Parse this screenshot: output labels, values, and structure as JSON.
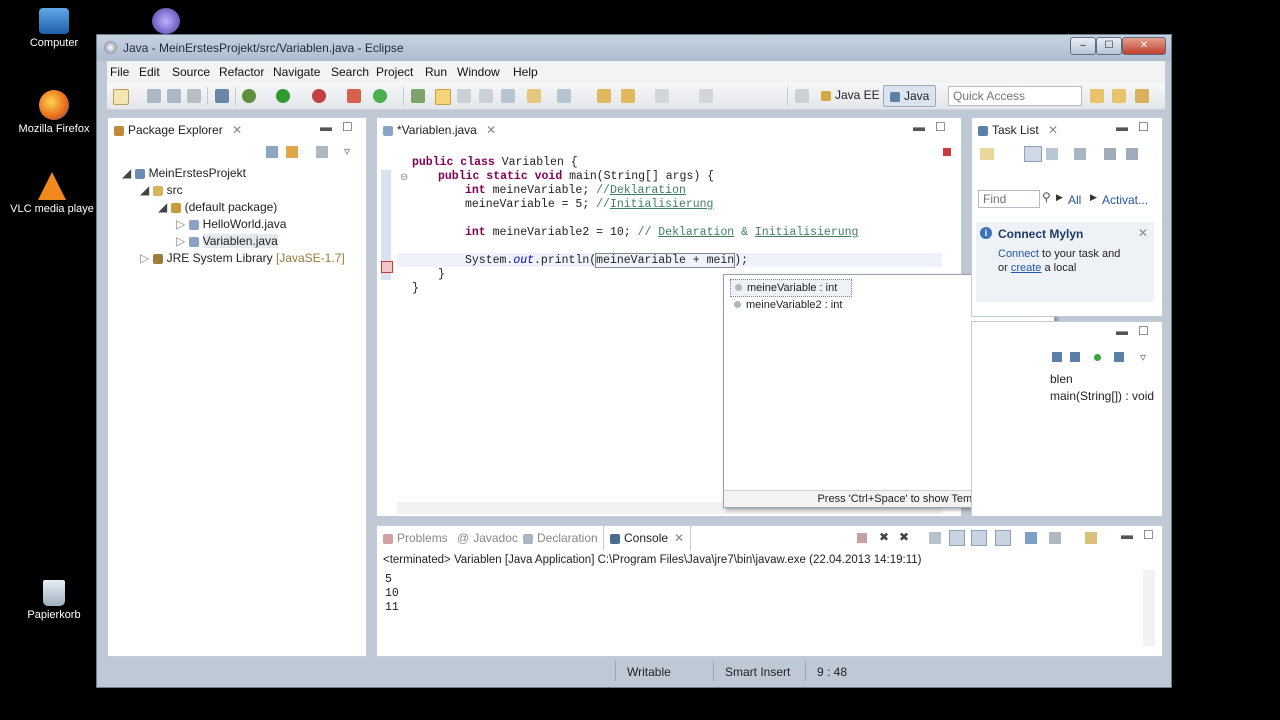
{
  "desktop": {
    "icons": [
      {
        "label": "Computer",
        "icon": "computer-icon"
      },
      {
        "label": "Mozilla Firefox",
        "icon": "firefox-icon"
      },
      {
        "label": "VLC media playe",
        "icon": "vlc-icon"
      },
      {
        "label": "Papierkorb",
        "icon": "recycle-bin-icon"
      }
    ]
  },
  "window": {
    "title": "Java - MeinErstesProjekt/src/Variablen.java - Eclipse",
    "controls": {
      "minimize": "‒",
      "maximize": "☐",
      "close": "✕"
    }
  },
  "menu": [
    "File",
    "Edit",
    "Source",
    "Refactor",
    "Navigate",
    "Search",
    "Project",
    "Run",
    "Window",
    "Help"
  ],
  "toolbar": {
    "perspective_java_ee": "Java EE",
    "perspective_java": "Java",
    "quick_access_placeholder": "Quick Access"
  },
  "package_explorer": {
    "tab": "Package Explorer",
    "tree": {
      "project": "MeinErstesProjekt",
      "src": "src",
      "package": "(default package)",
      "files": [
        "HelloWorld.java",
        "Variablen.java"
      ],
      "library": "JRE System Library",
      "library_version": "[JavaSE-1.7]"
    }
  },
  "editor": {
    "tab": "*Variablen.java",
    "code": {
      "l1_kw": "public class",
      "l1_rest": " Variablen {",
      "l2_kw": "public static void",
      "l2_rest": " main(String[] args) {",
      "l3_kw": "int",
      "l3_rest": " meineVariable; ",
      "l3_cm_prefix": "//",
      "l3_cm_word": "Deklaration",
      "l4_rest": "meineVariable = 5; ",
      "l4_cm_prefix": "//",
      "l4_cm_word": "Initialisierung",
      "l5_kw": "int",
      "l5_rest": " meineVariable2 = 10; ",
      "l5_cm_prefix": "// ",
      "l5_cm_word1": "Deklaration",
      "l5_cm_mid": " & ",
      "l5_cm_word2": "Initialisierung",
      "l6_a": "System.",
      "l6_out": "out",
      "l6_b": ".println(",
      "l6_c": "meineVariable + mein",
      "l6_d": ");",
      "l7": "}",
      "l8": "}"
    },
    "autocomplete": {
      "items": [
        "meineVariable : int",
        "meineVariable2 : int"
      ],
      "footer": "Press 'Ctrl+Space' to show Template Proposals"
    }
  },
  "task_list": {
    "tab": "Task List",
    "find_placeholder": "Find",
    "all": "All",
    "activate": "Activat...",
    "mylyn_title": "Connect Mylyn",
    "mylyn_connect": "Connect",
    "mylyn_text1": " to your task and",
    "mylyn_or": "or ",
    "mylyn_create": "create",
    "mylyn_text2": " a local"
  },
  "outline": {
    "item_class": "blen",
    "item_method": "main(String[]) : void"
  },
  "bottom_panel": {
    "tabs": [
      "Problems",
      "Javadoc",
      "Declaration",
      "Console"
    ],
    "console_header": "<terminated> Variablen [Java Application] C:\\Program Files\\Java\\jre7\\bin\\javaw.exe (22.04.2013 14:19:11)",
    "output": [
      "5",
      "10",
      "11"
    ]
  },
  "status_bar": {
    "writable": "Writable",
    "insert_mode": "Smart Insert",
    "position": "9 : 48"
  }
}
